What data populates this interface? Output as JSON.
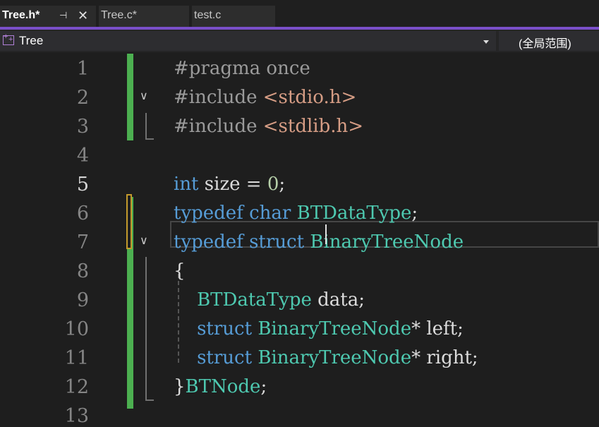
{
  "tabs": [
    {
      "label": "Tree.h*",
      "active": true
    },
    {
      "label": "Tree.c*",
      "active": false
    },
    {
      "label": "test.c",
      "active": false
    }
  ],
  "tab_pin_icon": "⊣",
  "tab_close_icon": "✕",
  "navbar": {
    "scope_left": "Tree",
    "scope_right": "(全局范围)",
    "icon": "class-icon"
  },
  "fold_glyph": "∨",
  "current_line": 5,
  "lines": [
    {
      "no": "1",
      "html": "<span class=\"pp\">#pragma once</span>"
    },
    {
      "no": "2",
      "html": "<span class=\"pp\">#include </span><span class=\"str\">&lt;stdio.h&gt;</span>"
    },
    {
      "no": "3",
      "html": "<span class=\"pp\">#include </span><span class=\"str\">&lt;stdlib.h&gt;</span>"
    },
    {
      "no": "4",
      "html": ""
    },
    {
      "no": "5",
      "html": "<span class=\"kw\">int</span> size = <span class=\"num\">0</span>;"
    },
    {
      "no": "6",
      "html": "<span class=\"kw\">typedef</span> <span class=\"kw\">char</span> <span class=\"ty\">BTDataType</span>;"
    },
    {
      "no": "7",
      "html": "<span class=\"kw\">typedef</span> <span class=\"kw\">struct</span> <span class=\"ty\">BinaryTreeNode</span>"
    },
    {
      "no": "8",
      "html": "{"
    },
    {
      "no": "9",
      "html": "    <span class=\"ty\">BTDataType</span> data;"
    },
    {
      "no": "10",
      "html": "    <span class=\"kw\">struct</span> <span class=\"ty\">BinaryTreeNode</span>* left;"
    },
    {
      "no": "11",
      "html": "    <span class=\"kw\">struct</span> <span class=\"ty\">BinaryTreeNode</span>* right;"
    },
    {
      "no": "12",
      "html": "}<span class=\"ty\">BTNode</span>;"
    },
    {
      "no": "13",
      "html": ""
    }
  ],
  "colors": {
    "accent": "#7a4fc9",
    "keyword": "#569cd6",
    "type": "#4ec9b0",
    "string": "#d69d85",
    "number": "#b5cea8",
    "change_saved": "#4caf50",
    "change_unsaved": "#c49a2c"
  }
}
